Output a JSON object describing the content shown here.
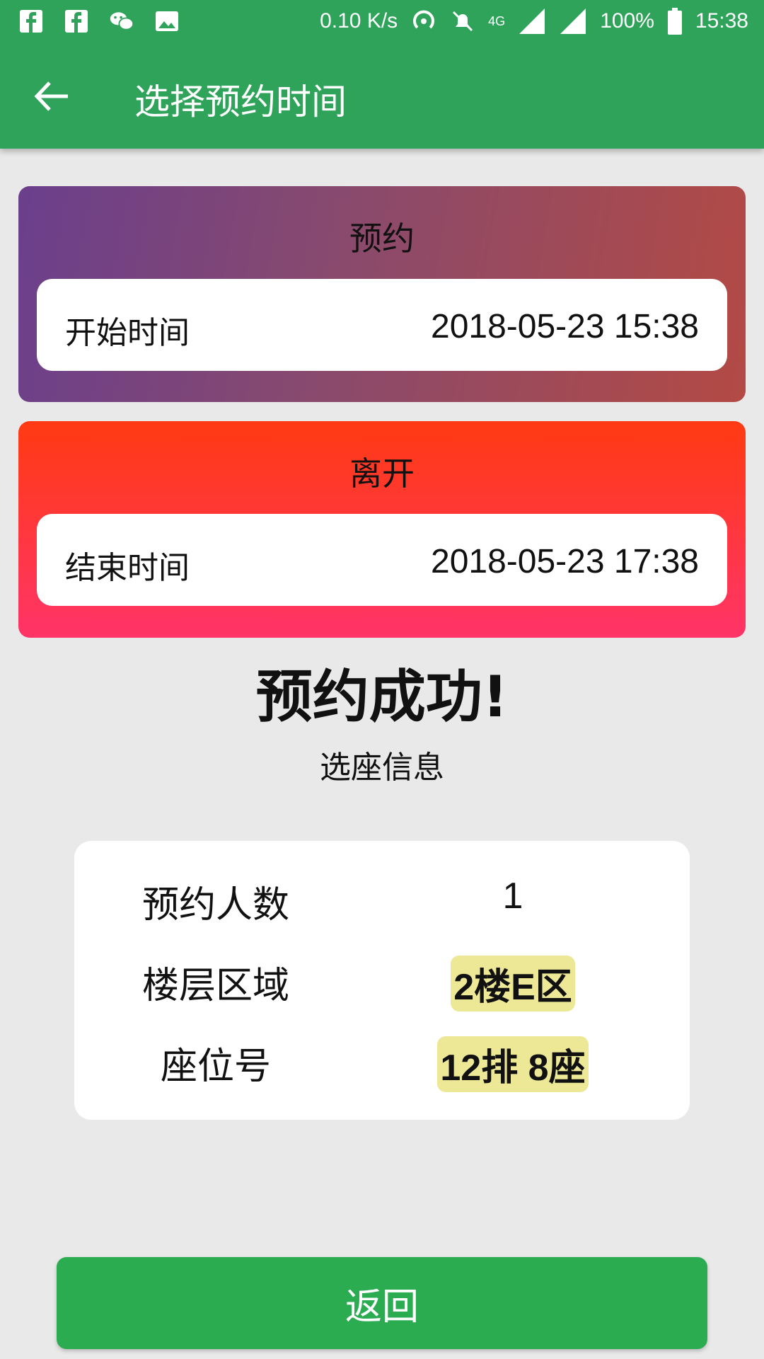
{
  "status_bar": {
    "speed": "0.10 K/s",
    "network": "4G",
    "battery": "100%",
    "time": "15:38"
  },
  "toolbar": {
    "title": "选择预约时间"
  },
  "reserve_card": {
    "title": "预约",
    "label": "开始时间",
    "value": "2018-05-23 15:38"
  },
  "leave_card": {
    "title": "离开",
    "label": "结束时间",
    "value": "2018-05-23 17:38"
  },
  "result": {
    "headline": "预约成功!",
    "subheading": "选座信息"
  },
  "info": {
    "rows": [
      {
        "label": "预约人数",
        "value": "1"
      },
      {
        "label": "楼层区域",
        "value": "2楼E区"
      },
      {
        "label": "座位号",
        "value": "12排 8座"
      }
    ]
  },
  "actions": {
    "return_label": "返回"
  },
  "colors": {
    "primary": "#2fa35a",
    "button": "#2bac51",
    "highlight": "#ece896"
  }
}
